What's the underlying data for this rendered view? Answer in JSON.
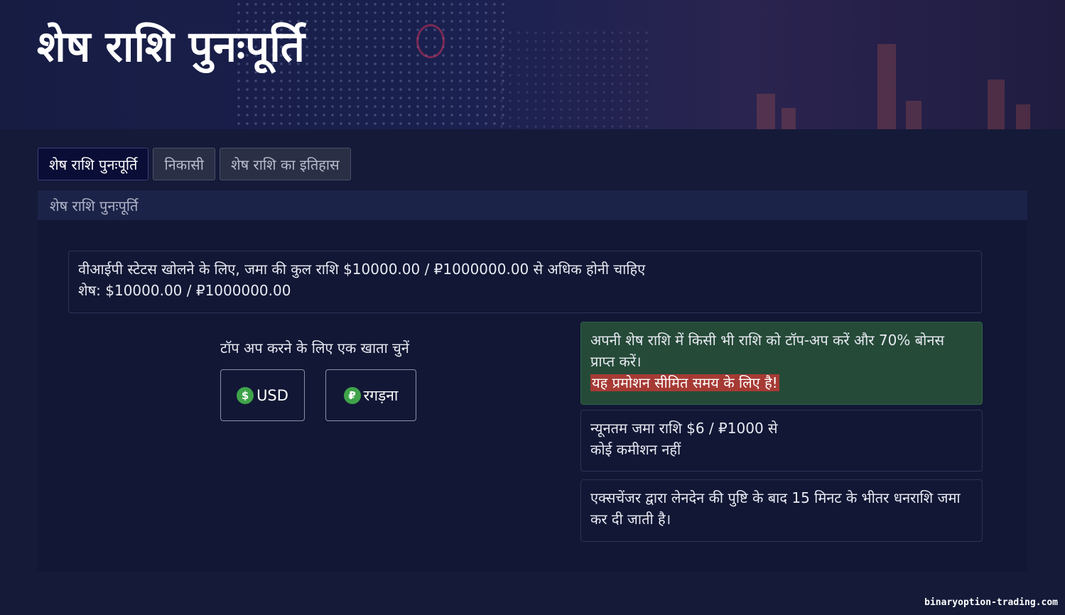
{
  "header": {
    "title": "शेष राशि पुनःपूर्ति"
  },
  "tabs": [
    {
      "label": "शेष राशि पुनःपूर्ति",
      "active": true
    },
    {
      "label": "निकासी",
      "active": false
    },
    {
      "label": "शेष राशि का इतिहास",
      "active": false
    }
  ],
  "section": {
    "title": "शेष राशि पुनःपूर्ति"
  },
  "vip": {
    "line1": "वीआईपी स्टेटस खोलने के लिए, जमा की कुल राशि $10000.00 / ₽1000000.00 से अधिक होनी चाहिए",
    "line2": "शेष: $10000.00 / ₽1000000.00"
  },
  "account": {
    "prompt": "टॉप अप करने के लिए एक खाता चुनें",
    "options": [
      {
        "icon": "$",
        "label": "USD"
      },
      {
        "icon": "₽",
        "label": "रगड़ना"
      }
    ]
  },
  "promo": {
    "text": "अपनी शेष राशि में किसी भी राशि को टॉप-अप करें और 70% बोनस प्राप्त करें।",
    "highlight": "यह प्रमोशन सीमित समय के लिए है!"
  },
  "minimum": {
    "line1": "न्यूनतम जमा राशि $6 / ₽1000 से",
    "line2": "कोई कमीशन नहीं"
  },
  "timing": {
    "text": "एक्सचेंजर द्वारा लेनदेन की पुष्टि के बाद 15 मिनट के भीतर धनराशि जमा कर दी जाती है।"
  },
  "watermark": "binaryoption-trading.com",
  "colors": {
    "accent_green": "#3fa34a",
    "promo_bg": "#254a38",
    "highlight_red": "#a63a34"
  }
}
